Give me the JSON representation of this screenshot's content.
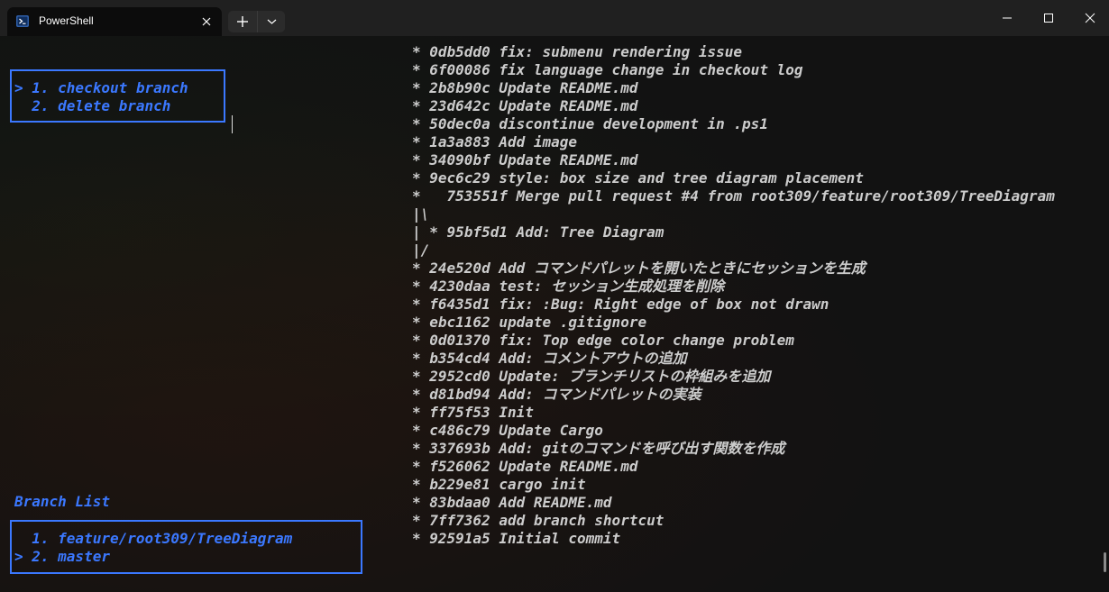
{
  "window": {
    "tab_title": "PowerShell"
  },
  "menu": {
    "items": [
      "> 1. checkout branch",
      "  2. delete branch"
    ]
  },
  "branch_list": {
    "title": "Branch List",
    "items": [
      "  1. feature/root309/TreeDiagram",
      "> 2. master"
    ]
  },
  "git_log": [
    "* 0db5dd0 fix: submenu rendering issue",
    "* 6f00086 fix language change in checkout log",
    "* 2b8b90c Update README.md",
    "* 23d642c Update README.md",
    "* 50dec0a discontinue development in .ps1",
    "* 1a3a883 Add image",
    "* 34090bf Update README.md",
    "* 9ec6c29 style: box size and tree diagram placement",
    "*   753551f Merge pull request #4 from root309/feature/root309/TreeDiagram",
    "|\\",
    "| * 95bf5d1 Add: Tree Diagram",
    "|/",
    "* 24e520d Add コマンドパレットを開いたときにセッションを生成",
    "* 4230daa test: セッション生成処理を削除",
    "* f6435d1 fix: :Bug: Right edge of box not drawn",
    "* ebc1162 update .gitignore",
    "* 0d01370 fix: Top edge color change problem",
    "* b354cd4 Add: コメントアウトの追加",
    "* 2952cd0 Update: ブランチリストの枠組みを追加",
    "* d81bd94 Add: コマンドパレットの実装",
    "* ff75f53 Init",
    "* c486c79 Update Cargo",
    "* 337693b Add: gitのコマンドを呼び出す関数を作成",
    "* f526062 Update README.md",
    "* b229e81 cargo init",
    "* 83bdaa0 Add README.md",
    "* 7ff7362 add branch shortcut",
    "* 92591a5 Initial commit"
  ]
}
